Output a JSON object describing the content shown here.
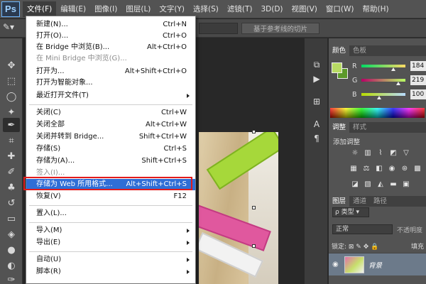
{
  "app": {
    "logo": "Ps"
  },
  "menubar": {
    "items": [
      "文件(F)",
      "编辑(E)",
      "图像(I)",
      "图层(L)",
      "文字(Y)",
      "选择(S)",
      "滤镜(T)",
      "3D(D)",
      "视图(V)",
      "窗口(W)",
      "帮助(H)"
    ],
    "active_index": 0
  },
  "options_bar": {
    "button_label": "基于参考线的切片"
  },
  "file_menu": {
    "items": [
      {
        "label": "新建(N)...",
        "shortcut": "Ctrl+N"
      },
      {
        "label": "打开(O)...",
        "shortcut": "Ctrl+O"
      },
      {
        "label": "在 Bridge 中浏览(B)...",
        "shortcut": "Alt+Ctrl+O"
      },
      {
        "label": "在 Mini Bridge 中浏览(G)...",
        "shortcut": ""
      },
      {
        "label": "打开为...",
        "shortcut": "Alt+Shift+Ctrl+O"
      },
      {
        "label": "打开为智能对象...",
        "shortcut": ""
      },
      {
        "label": "最近打开文件(T)",
        "shortcut": ""
      },
      {
        "label": "关闭(C)",
        "shortcut": "Ctrl+W"
      },
      {
        "label": "关闭全部",
        "shortcut": "Alt+Ctrl+W"
      },
      {
        "label": "关闭并转到 Bridge...",
        "shortcut": "Shift+Ctrl+W"
      },
      {
        "label": "存储(S)",
        "shortcut": "Ctrl+S"
      },
      {
        "label": "存储为(A)...",
        "shortcut": "Shift+Ctrl+S"
      },
      {
        "label": "签入(I)...",
        "shortcut": ""
      },
      {
        "label": "存储为 Web 所用格式...",
        "shortcut": "Alt+Shift+Ctrl+S"
      },
      {
        "label": "恢复(V)",
        "shortcut": "F12"
      },
      {
        "label": "置入(L)...",
        "shortcut": ""
      },
      {
        "label": "导入(M)",
        "shortcut": ""
      },
      {
        "label": "导出(E)",
        "shortcut": ""
      },
      {
        "label": "自动(U)",
        "shortcut": ""
      },
      {
        "label": "脚本(R)",
        "shortcut": ""
      }
    ]
  },
  "color_panel": {
    "tabs": [
      "颜色",
      "色板"
    ],
    "fg_color": "#b8db64",
    "bg_color": "#5c9a2a",
    "channels": [
      {
        "label": "R",
        "value": "184"
      },
      {
        "label": "G",
        "value": "219"
      },
      {
        "label": "B",
        "value": "100"
      }
    ]
  },
  "adjust_panel": {
    "tabs": [
      "调整",
      "样式"
    ],
    "title": "添加调整"
  },
  "layers_panel": {
    "tabs": [
      "图层",
      "通道",
      "路径"
    ],
    "kind": "类型",
    "mode": "正常",
    "opacity_label": "不透明度",
    "lock_label": "锁定:",
    "fill_label": "填充",
    "layer_name": "背景"
  }
}
